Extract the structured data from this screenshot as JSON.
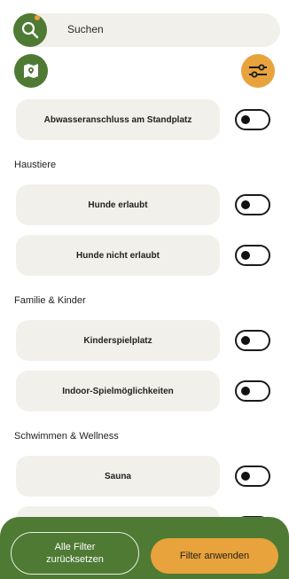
{
  "search": {
    "placeholder": "Suchen"
  },
  "sections": {
    "haustiere": "Haustiere",
    "familie": "Familie & Kinder",
    "schwimmen": "Schwimmen & Wellness"
  },
  "filters": {
    "abwasser": "Abwasseranschluss am Standplatz",
    "hunde_erlaubt": "Hunde erlaubt",
    "hunde_nicht": "Hunde nicht erlaubt",
    "spielplatz": "Kinderspielplatz",
    "indoor": "Indoor-Spielmöglichkeiten",
    "sauna": "Sauna"
  },
  "toggles_on": false,
  "buttons": {
    "reset": "Alle Filter zurücksetzen",
    "apply": "Filter anwenden"
  },
  "colors": {
    "brand_green": "#4e7a33",
    "accent_orange": "#e8a33c",
    "card_bg": "#f1f0ea"
  }
}
